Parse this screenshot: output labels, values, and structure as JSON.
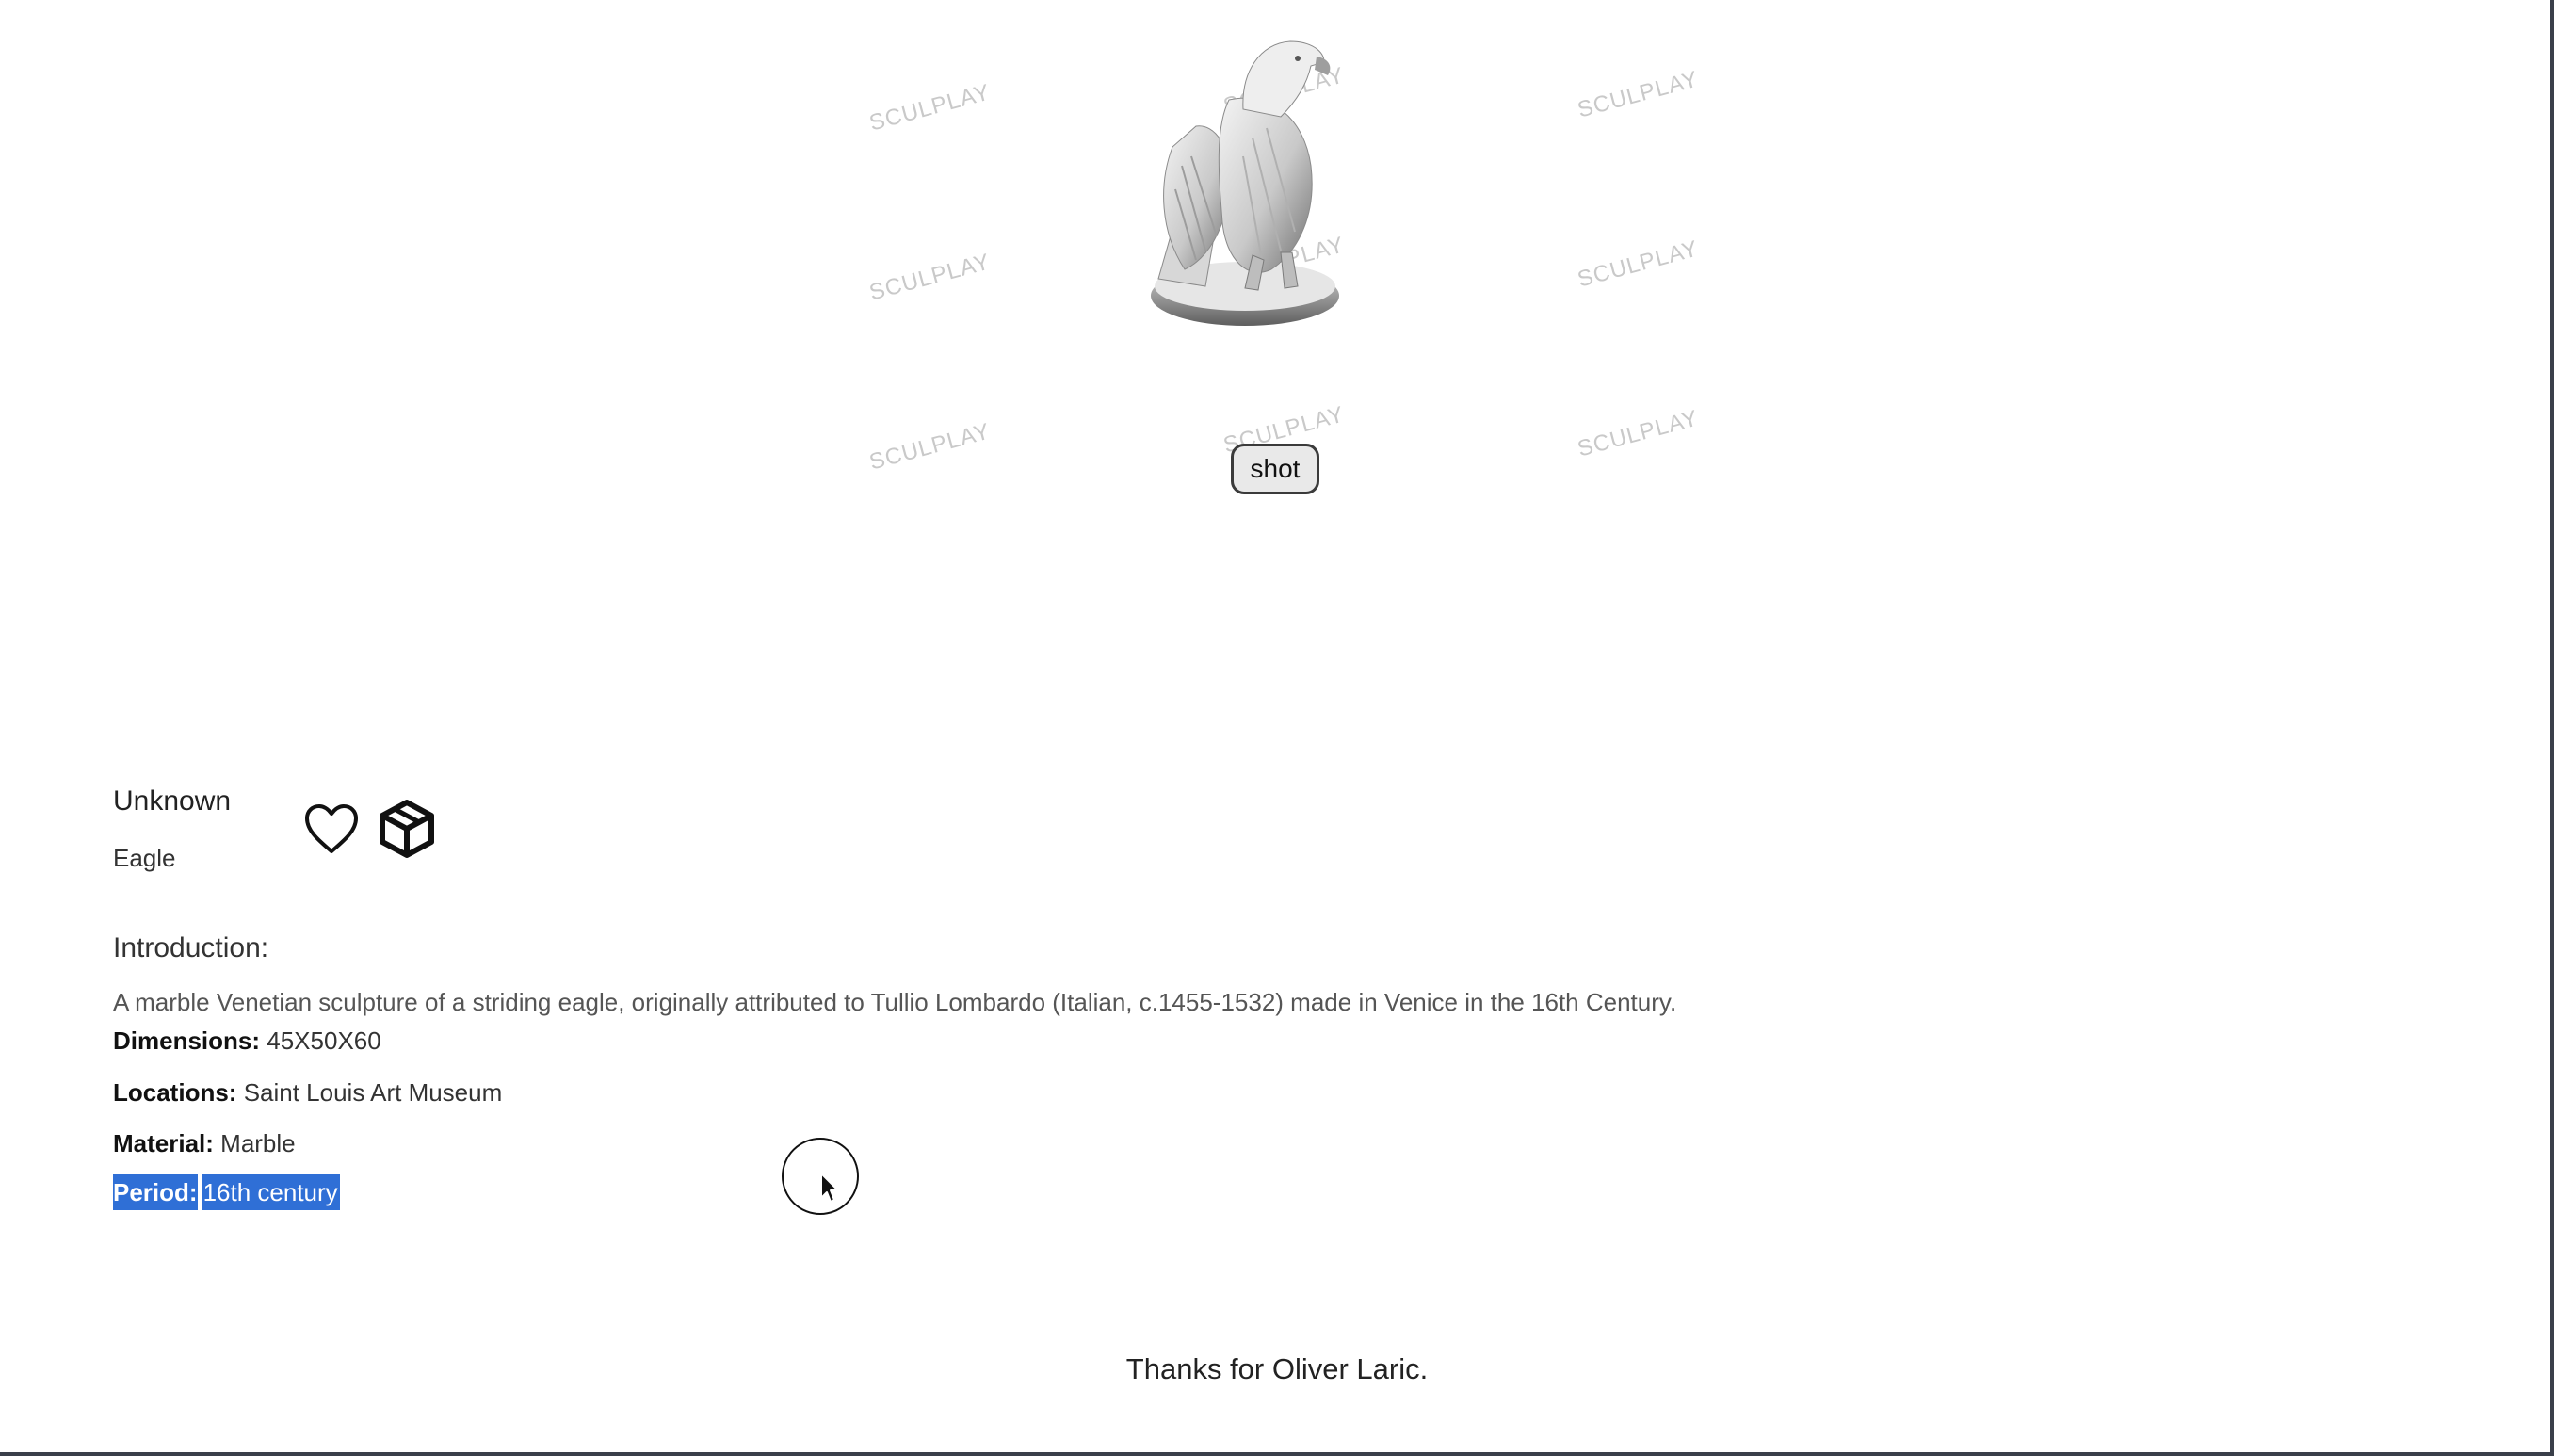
{
  "viewer": {
    "watermark_text": "SCULPLAY",
    "shot_label": "shot"
  },
  "sculpture": {
    "artist": "Unknown",
    "title": "Eagle",
    "actions": {
      "favorite_icon": "heart-icon",
      "model_icon": "cube-icon"
    }
  },
  "introduction": {
    "heading": "Introduction:",
    "text": "A marble Venetian sculpture of a striding eagle, originally attributed to Tullio Lombardo (Italian, c.1455-1532) made in Venice in the 16th Century."
  },
  "properties": {
    "dimensions": {
      "label": "Dimensions:",
      "value": "45X50X60"
    },
    "locations": {
      "label": "Locations:",
      "value": "Saint Louis Art Museum"
    },
    "material": {
      "label": "Material:",
      "value": "Marble"
    },
    "period": {
      "label": "Period:",
      "value": "16th century"
    }
  },
  "footer": {
    "thanks": "Thanks for Oliver Laric."
  },
  "colors": {
    "selection": "#2f6fd6",
    "watermark": "#c9c9c9"
  }
}
